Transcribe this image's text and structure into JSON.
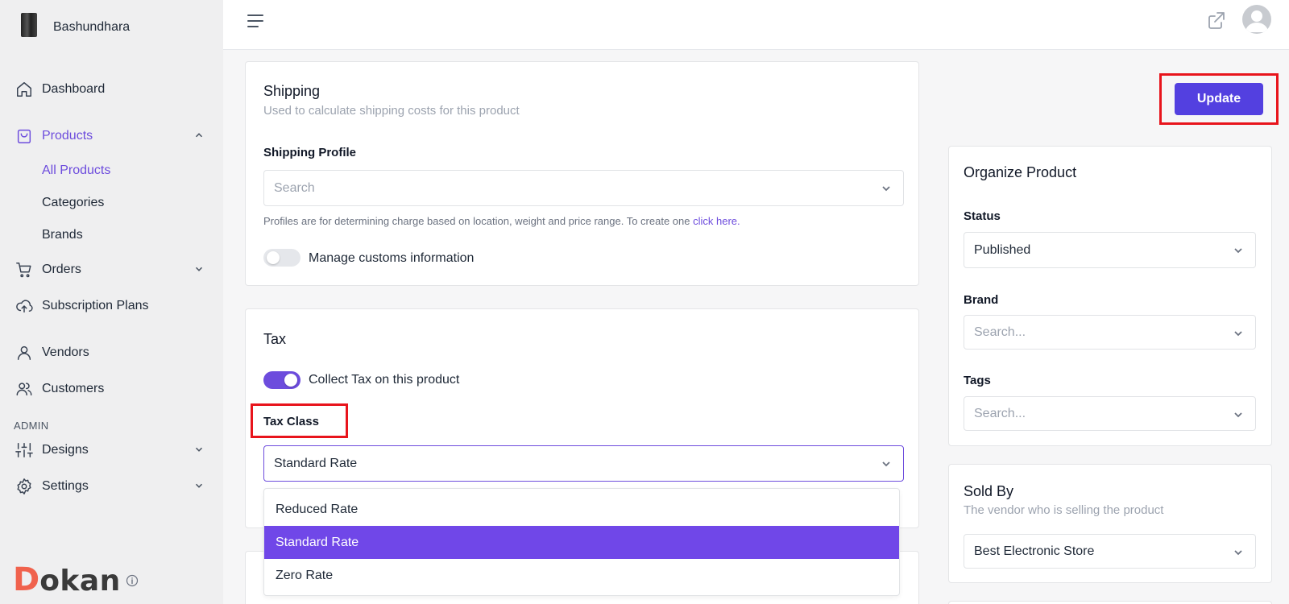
{
  "store": {
    "name": "Bashundhara"
  },
  "sidebar": {
    "items": [
      {
        "label": "Dashboard",
        "icon": "home-icon"
      },
      {
        "label": "Products",
        "icon": "shopping-bag-icon",
        "active": true,
        "expanded": true
      },
      {
        "label": "Orders",
        "icon": "cart-icon"
      },
      {
        "label": "Subscription Plans",
        "icon": "cloud-upload-icon"
      },
      {
        "label": "Vendors",
        "icon": "user-icon"
      },
      {
        "label": "Customers",
        "icon": "users-icon"
      },
      {
        "label": "Designs",
        "icon": "sliders-icon"
      },
      {
        "label": "Settings",
        "icon": "gear-icon"
      }
    ],
    "products_sub": [
      "All Products",
      "Categories",
      "Brands"
    ],
    "admin_label": "ADMIN",
    "logo": {
      "first_letter": "D",
      "rest": "okan"
    }
  },
  "shipping": {
    "title": "Shipping",
    "subtitle": "Used to calculate shipping costs for this product",
    "profile_label": "Shipping Profile",
    "profile_placeholder": "Search",
    "help_text": "Profiles are for determining charge based on location, weight and price range. To create one ",
    "help_link": "click here.",
    "customs_label": "Manage customs information",
    "customs_enabled": false
  },
  "tax": {
    "title": "Tax",
    "collect_label": "Collect Tax on this product",
    "collect_enabled": true,
    "class_label": "Tax Class",
    "class_value": "Standard Rate",
    "options": [
      "Reduced Rate",
      "Standard Rate",
      "Zero Rate"
    ],
    "selected_option": "Standard Rate"
  },
  "actions": {
    "update_label": "Update"
  },
  "organize": {
    "title": "Organize Product",
    "status_label": "Status",
    "status_value": "Published",
    "brand_label": "Brand",
    "brand_placeholder": "Search...",
    "tags_label": "Tags",
    "tags_placeholder": "Search..."
  },
  "sold_by": {
    "title": "Sold By",
    "subtitle": "The vendor who is selling the product",
    "vendor_value": "Best Electronic Store"
  },
  "colors": {
    "accent": "#6d4cdd",
    "button": "#5340e0",
    "highlight": "#e8141c",
    "logo_accent": "#f0624d"
  }
}
